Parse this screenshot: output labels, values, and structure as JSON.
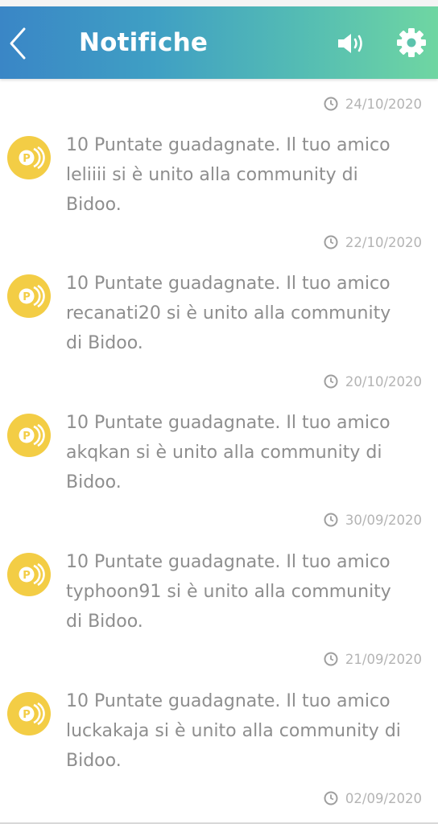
{
  "header": {
    "title": "Notifiche",
    "back_icon": "chevron-left-icon",
    "sound_icon": "volume-icon",
    "settings_icon": "gear-icon",
    "gradient_start": "#3a86c6",
    "gradient_end": "#6fd6a2"
  },
  "colors": {
    "coin": "#f3cd45",
    "text": "#8e8e8e",
    "date": "#b4b4b4"
  },
  "top_date": "24/10/2020",
  "notifications": [
    {
      "text": "10 Puntate guadagnate. Il tuo amico\nleliiii si è unito alla community di\nBidoo.",
      "date": "22/10/2020",
      "icon": "bid-coin-icon"
    },
    {
      "text": "10 Puntate guadagnate. Il tuo amico\nrecanati20 si è unito alla community\ndi Bidoo.",
      "date": "20/10/2020",
      "icon": "bid-coin-icon"
    },
    {
      "text": "10 Puntate guadagnate. Il tuo amico\nakqkan si è unito alla community di\nBidoo.",
      "date": "30/09/2020",
      "icon": "bid-coin-icon"
    },
    {
      "text": "10 Puntate guadagnate. Il tuo amico\ntyphoon91 si è unito alla community\ndi Bidoo.",
      "date": "21/09/2020",
      "icon": "bid-coin-icon"
    },
    {
      "text": "10 Puntate guadagnate. Il tuo amico\nluckakaja si è unito alla community di\nBidoo.",
      "date": "02/09/2020",
      "icon": "bid-coin-icon"
    }
  ]
}
